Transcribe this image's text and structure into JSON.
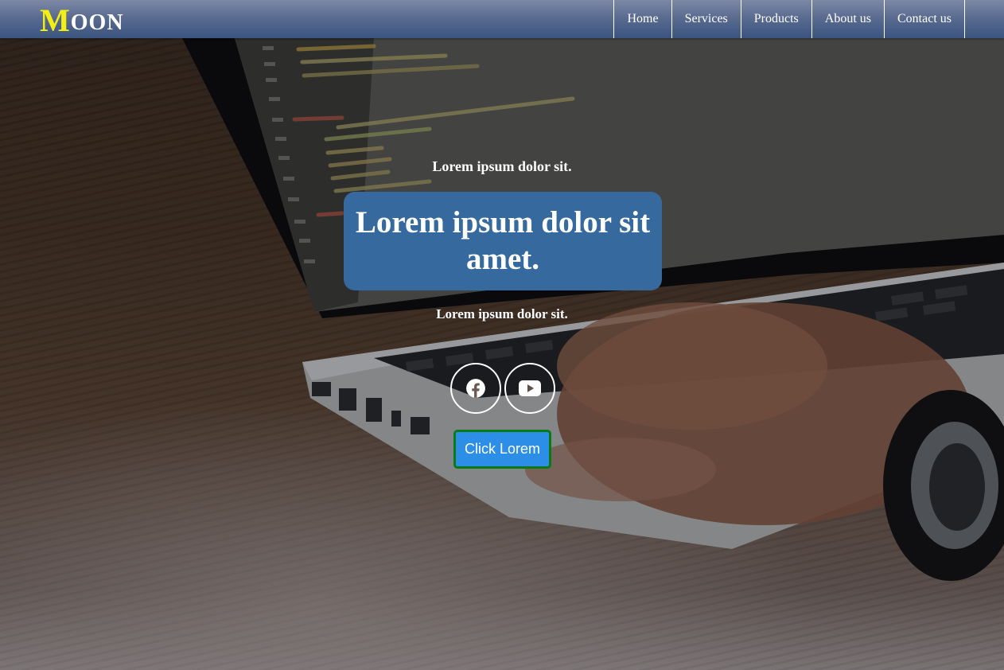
{
  "brand": {
    "first_letter": "M",
    "rest": "OON"
  },
  "nav": {
    "items": [
      {
        "label": "Home"
      },
      {
        "label": "Services"
      },
      {
        "label": "Products"
      },
      {
        "label": "About us"
      },
      {
        "label": "Contact us"
      }
    ]
  },
  "hero": {
    "kicker_top": "Lorem ipsum dolor sit.",
    "headline": "Lorem ipsum dolor sit amet.",
    "kicker_bottom": "Lorem ipsum dolor sit.",
    "cta_label": "Click Lorem",
    "social": [
      {
        "icon": "facebook-icon"
      },
      {
        "icon": "youtube-icon"
      }
    ]
  },
  "colors": {
    "navbar": "#3a5480",
    "logo_accent": "#f3ef15",
    "headline_box": "#366a9f",
    "cta_fill": "#2d8ee8",
    "cta_border": "#0c7a14"
  }
}
